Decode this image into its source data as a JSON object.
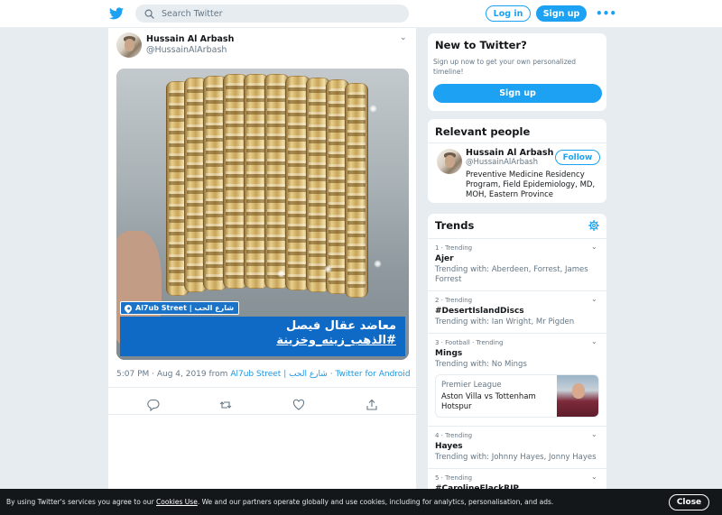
{
  "header": {
    "search_placeholder": "Search Twitter",
    "login_label": "Log in",
    "signup_label": "Sign up",
    "more_label": "•••",
    "brand_color": "#1da1f2"
  },
  "tweet": {
    "author_name": "Hussain Al Arbash",
    "author_handle": "@HussainAlArbash",
    "location_tag": "Al7ub Street | شارع الحب",
    "caption_line1": "معاضد عقال فيصل",
    "caption_line2": "#الذهب_زينه_وخزينة",
    "timestamp": "5:07 PM · Aug 4, 2019 from",
    "place_link": "Al7ub Street | شارع الحب",
    "separator": "·",
    "source_link": "Twitter for Android"
  },
  "sidebar": {
    "new_to_twitter": {
      "title": "New to Twitter?",
      "text": "Sign up now to get your own personalized timeline!",
      "button": "Sign up"
    },
    "relevant_people": {
      "title": "Relevant people",
      "name": "Hussain Al Arbash",
      "handle": "@HussainAlArbash",
      "follow_label": "Follow",
      "bio": "Preventive Medicine Residency Program, Field Epidemiology, MD, MOH, Eastern Province"
    },
    "trends": {
      "title": "Trends",
      "items": [
        {
          "meta": "1 · Trending",
          "name": "Ajer",
          "with": "Trending with: Aberdeen, Forrest, James Forrest"
        },
        {
          "meta": "2 · Trending",
          "name": "#DesertIslandDiscs",
          "with": "Trending with: Ian Wright, Mr Pigden"
        },
        {
          "meta": "3 · Football · Trending",
          "name": "Mings",
          "with": "Trending with: No Mings",
          "news": {
            "source": "Premier League",
            "headline": "Aston Villa vs Tottenham Hotspur"
          }
        },
        {
          "meta": "4 · Trending",
          "name": "Hayes",
          "with": "Trending with: Johnny Hayes, Jonny Hayes"
        },
        {
          "meta": "5 · Trending",
          "name": "#CarolineFlackRIP",
          "with": ""
        }
      ]
    }
  },
  "cookie_banner": {
    "text_before": "By using Twitter's services you agree to our",
    "link": "Cookies Use",
    "text_after": ". We and our partners operate globally and use cookies, including for analytics, personalisation, and ads.",
    "close_label": "Close"
  }
}
